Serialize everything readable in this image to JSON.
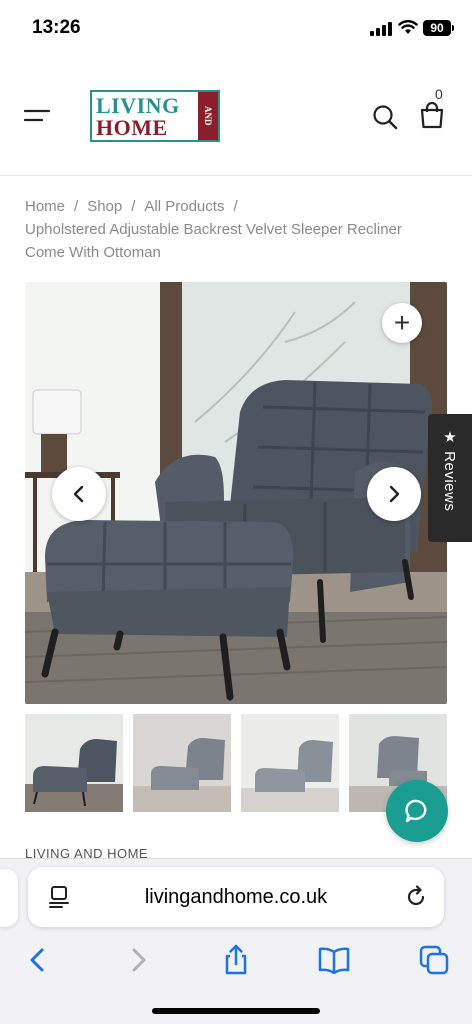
{
  "status_bar": {
    "time": "13:26",
    "battery": "90"
  },
  "header": {
    "logo_line1": "LIVING",
    "logo_line2": "HOME",
    "logo_and": "AND",
    "cart_count": "0"
  },
  "breadcrumb": {
    "items": [
      "Home",
      "Shop",
      "All Products"
    ],
    "separator": "/",
    "current": "Upholstered Adjustable Backrest Velvet Sleeper Recliner Come With Ottoman"
  },
  "product": {
    "zoom_symbol": "+",
    "reviews_label": "★ Reviews",
    "thumbnail_count": 4
  },
  "brand_label": "LIVING AND HOME",
  "browser": {
    "url": "livingandhome.co.uk"
  },
  "colors": {
    "teal": "#2a8f8f",
    "burgundy": "#8b1d2c",
    "chat": "#1a9e92",
    "ios_blue": "#1a73e8"
  }
}
